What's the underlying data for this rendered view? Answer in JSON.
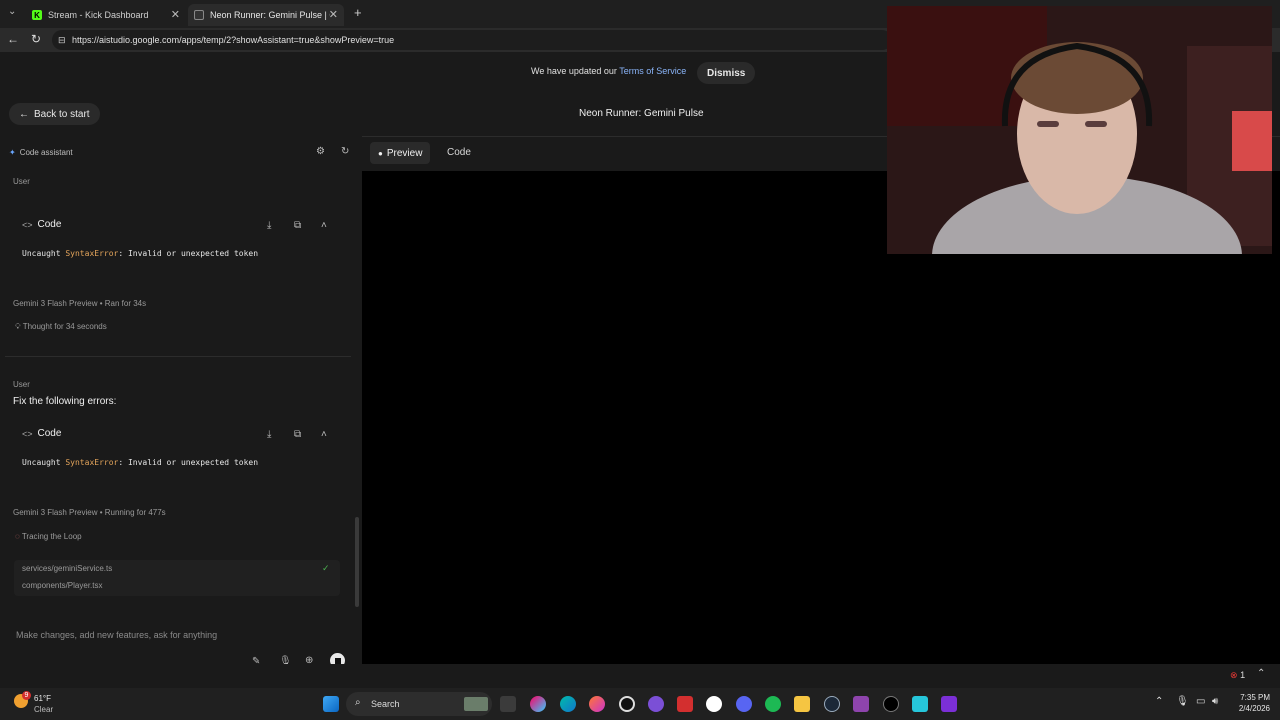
{
  "browser": {
    "tabs": [
      {
        "label": "Stream - Kick Dashboard",
        "favicon": "kick-icon",
        "active": false
      },
      {
        "label": "Neon Runner: Gemini Pulse | Goo",
        "favicon": "google-icon",
        "active": true
      }
    ],
    "new_tab": "+",
    "url": "https://aistudio.google.com/apps/temp/2?showAssistant=true&showPreview=true"
  },
  "banner": {
    "text": "We have updated our",
    "link": "Terms of Service",
    "dismiss": "Dismiss"
  },
  "header": {
    "back_label": "Back to start",
    "title": "Neon Runner: Gemini Pulse"
  },
  "assistant": {
    "label": "Code assistant",
    "messages": {
      "user1_role": "User",
      "code1_title": "Code",
      "code1_line_prefix": "Uncaught ",
      "code1_error": "SyntaxError",
      "code1_line_suffix": ": Invalid or unexpected token",
      "model1_name": "Gemini 3 Flash Preview",
      "model1_status": "Ran for 34s",
      "model1_thought": "Thought for 34 seconds",
      "user2_role": "User",
      "user2_text": "Fix the following errors:",
      "code2_title": "Code",
      "code2_line_prefix": "Uncaught ",
      "code2_error": "SyntaxError",
      "code2_line_suffix": ": Invalid or unexpected token",
      "model2_name": "Gemini 3 Flash Preview",
      "model2_status": "Running for 477s",
      "model2_step": "Tracing the Loop",
      "files": [
        "services/geminiService.ts",
        "components/Player.tsx"
      ]
    },
    "input_placeholder": "Make changes, add new features, ask for anything"
  },
  "view_tabs": {
    "preview": "Preview",
    "code": "Code"
  },
  "status": {
    "error_count": "1"
  },
  "taskbar": {
    "weather_temp": "61°F",
    "weather_cond": "Clear",
    "weather_badge": "9",
    "search": "Search",
    "time": "7:35 PM",
    "date": "2/4/2026"
  }
}
